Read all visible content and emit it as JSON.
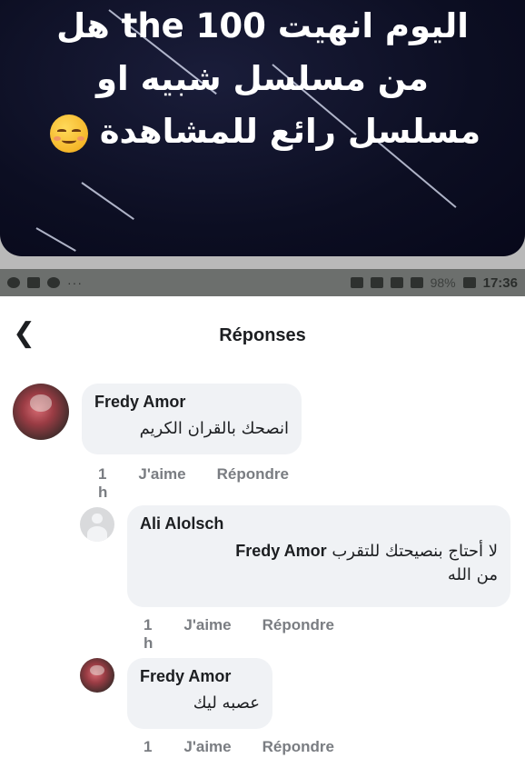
{
  "post": {
    "line1": "اليوم انهيت the 100 هل",
    "line2": "من مسلسل شبيه او",
    "line3": "مسلسل رائع للمشاهدة",
    "emoji": "relieved-face-emoji"
  },
  "statusbar": {
    "left_dots": "···",
    "battery": "98%",
    "time": "17:36"
  },
  "screen": {
    "title": "Réponses",
    "back_icon": "chevron-left-icon"
  },
  "comments": [
    {
      "author": "Fredy Amor",
      "text": "انصحك بالقران الكريم",
      "time": "1 h",
      "like": "J'aime",
      "reply": "Répondre"
    },
    {
      "author": "Ali Alolsch",
      "mention": "Fredy Amor",
      "text_before": "لا أحتاج بنصيحتك للتقرب",
      "text_after": "من الله",
      "time": "1 h",
      "like": "J'aime",
      "reply": "Répondre"
    },
    {
      "author": "Fredy Amor",
      "text": "عصبه ليك",
      "time": "1 h",
      "like": "J'aime",
      "reply": "Répondre"
    }
  ]
}
